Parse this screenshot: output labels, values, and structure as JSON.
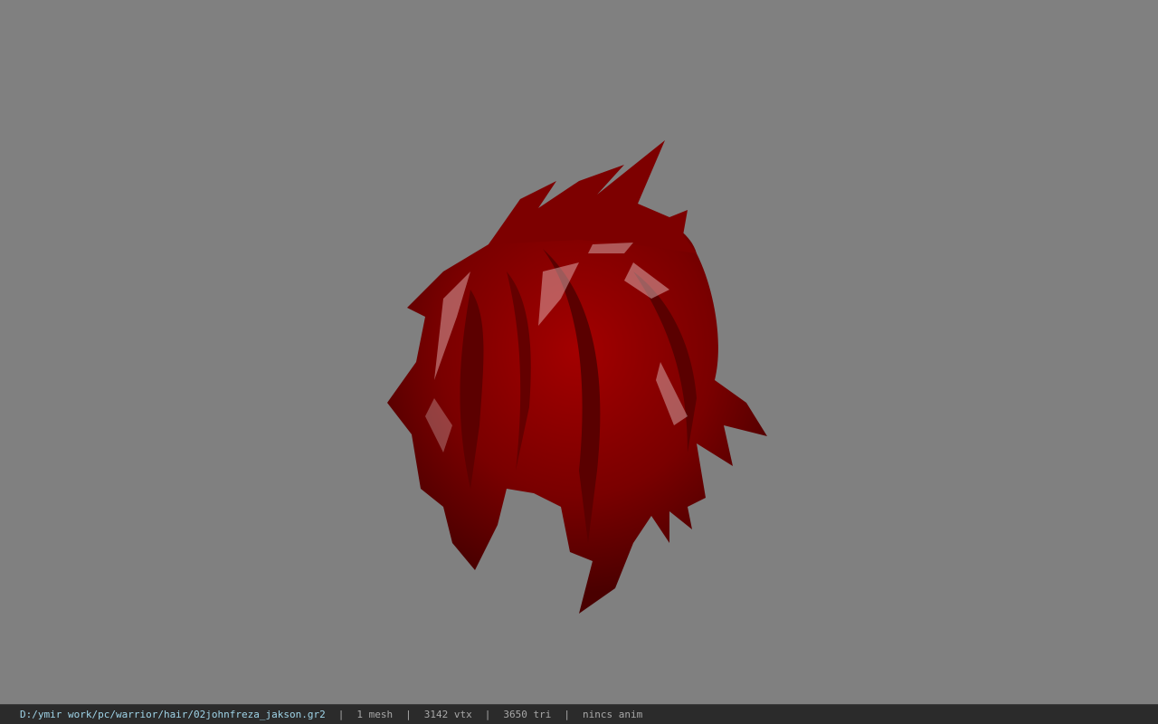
{
  "viewer": {
    "background_color": "#808080",
    "model_name": "hair-mesh",
    "model_color": "#8a0000"
  },
  "status": {
    "file_path": "D:/ymir work/pc/warrior/hair/02johnfreza_jakson.gr2",
    "separator": "|",
    "mesh_count": "1 mesh",
    "vertex_count": "3142 vtx",
    "triangle_count": "3650 tri",
    "anim_state": "nincs anim"
  }
}
